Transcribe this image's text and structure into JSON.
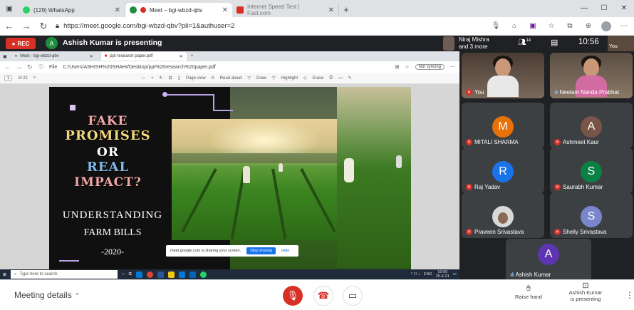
{
  "browser": {
    "tabs": [
      {
        "label": "(129) WhatsApp",
        "favicon_color": "#25d366"
      },
      {
        "label": "Meet – bgi-wbzd-qbv",
        "favicon_color": "#1e8e3e"
      },
      {
        "label": "Internet Speed Test | Fast.com",
        "favicon_color": "#d93025"
      }
    ],
    "url": "https://meet.google.com/bgi-wbzd-qbv?pli=1&authuser=2"
  },
  "meet": {
    "rec_label": "REC",
    "presenter_initial": "A",
    "presenting_text": "Ashish Kumar is presenting",
    "pinned_name": "Niraj Mishra",
    "pinned_more": "and 3 more",
    "people_count": "14",
    "clock": "10:56",
    "self_label": "You"
  },
  "shared": {
    "inner_tabs": [
      {
        "label": "Meet - bgi-wbzd-qbv"
      },
      {
        "label": "ppt research paper.pdf"
      }
    ],
    "file_label": "File",
    "file_path": "C:/Users/ASHISH%20SHAHI/Desktop/ppt%20research%20paper.pdf",
    "sync_label": "Not syncing",
    "page_num": "1",
    "page_total": "of 22",
    "toolbar": {
      "page_view": "Page view",
      "read_aloud": "Read aloud",
      "draw": "Draw",
      "highlight": "Highlight",
      "erase": "Erase"
    },
    "slide": {
      "line1": "FAKE",
      "line2": "PROMISES",
      "line3": "OR",
      "line4": "REAL",
      "line5": "IMPACT?",
      "subtitle1": "UNDERSTANDING",
      "subtitle2": "FARM BILLS",
      "year": "-2020-"
    },
    "share_notice": "meet.google.com is sharing your screen.",
    "stop_sharing": "Stop sharing",
    "hide": "Hide",
    "taskbar_search": "Type here to search",
    "taskbar_lang": "ENG",
    "taskbar_time": "10:56",
    "taskbar_date": "25-4-21"
  },
  "participants": [
    {
      "name": "You",
      "initial": "",
      "color": "",
      "mic": "muted"
    },
    {
      "name": "Neelam Nanda Prabhat",
      "initial": "",
      "color": "",
      "mic": "speaking"
    },
    {
      "name": "MITALI SHARMA",
      "initial": "M",
      "color": "#e8710a",
      "mic": "muted"
    },
    {
      "name": "Ashmeet Kaur",
      "initial": "A",
      "color": "#795548",
      "mic": "muted"
    },
    {
      "name": "Raj Yadav",
      "initial": "R",
      "color": "#1a73e8",
      "mic": "muted"
    },
    {
      "name": "Saurabh Kumar",
      "initial": "S",
      "color": "#0b8043",
      "mic": "muted"
    },
    {
      "name": "Praveen Srivastava",
      "initial": "",
      "color": "",
      "mic": "muted"
    },
    {
      "name": "Shelly Srivastava",
      "initial": "S",
      "color": "#7986cb",
      "mic": "muted"
    }
  ],
  "presenter_tile": {
    "name": "Ashish Kumar",
    "initial": "A",
    "color": "#5e35b1"
  },
  "bottom": {
    "meeting_details": "Meeting details",
    "raise_hand": "Raise hand",
    "presenting_line1": "Ashish Kumar",
    "presenting_line2": "is presenting"
  }
}
